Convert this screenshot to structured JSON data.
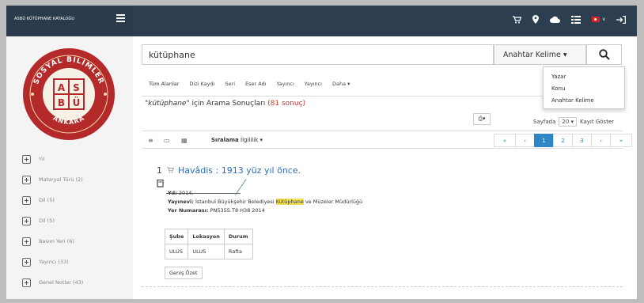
{
  "topbar": {
    "brand": "ASBÜ KÜTÜPHANE KATALOĞU",
    "icons": [
      "cart-icon",
      "map-pin-icon",
      "cloud-icon",
      "list-icon",
      "flag-tr-icon",
      "sign-in-icon"
    ],
    "lang_caret": "v"
  },
  "logo": {
    "top_text": "SOSYAL BİLİMLER",
    "left_text": "SOSYAL",
    "right_text": "ÜNİVERSİTESİ",
    "bottom_text": "ANKARA",
    "letters": [
      "A",
      "S",
      "B",
      "Ü"
    ]
  },
  "sidebar": {
    "facets": [
      {
        "label": "Yıl"
      },
      {
        "label": "Materyal Türü (2)"
      },
      {
        "label": "Dil (5)"
      },
      {
        "label": "Dil (5)"
      },
      {
        "label": "Basım Yeri (6)"
      },
      {
        "label": "Yayıncı (33)"
      },
      {
        "label": "Genel Notlar (43)"
      }
    ]
  },
  "search": {
    "query": "kütüphane",
    "type_label": "Anahtar Kelime ▾"
  },
  "dropdown": {
    "options": [
      "Yazar",
      "Konu",
      "Anahtar Kelime"
    ]
  },
  "tabs": [
    "Tüm Alanlar",
    "Dizi Kaydı",
    "Seri",
    "Eser Adı",
    "Yayıncı",
    "Yayıncı",
    "Daha ▾"
  ],
  "results": {
    "query_quoted": "\"kütüphane\"",
    "title_mid": " için Arama Sonuçları ",
    "count": "(81 sonuç)",
    "print_label": "⎙▾",
    "perpage_prefix": "Sayfada",
    "perpage_value": "20 ▾",
    "perpage_suffix": "Kayıt Göster"
  },
  "toolbar": {
    "sort_label": "Sıralama",
    "sort_value": "İlgililik ▾",
    "pages": [
      "«",
      "‹",
      "1",
      "2",
      "3",
      "›",
      "»"
    ],
    "active_page": "1"
  },
  "record": {
    "number": "1",
    "title": "Havâdis : 1913 yüz yıl önce.",
    "year_label": "Yıl:",
    "year": "2014.",
    "publisher_label": "Yayınevi:",
    "publisher_pre": "İstanbul Büyükşehir Belediyesi ",
    "publisher_hl": "Kütüphane",
    "publisher_post": " ve Müzeler Müdürlüğü",
    "callno_label": "Yer Numarası:",
    "callno": "PN5355.T8 H38 2014",
    "table_headers": [
      "Şube",
      "Lokasyon",
      "Durum"
    ],
    "table_row": [
      "ULUS",
      "ULUS",
      "Rafta"
    ],
    "summary_button": "Geniş Özet"
  }
}
